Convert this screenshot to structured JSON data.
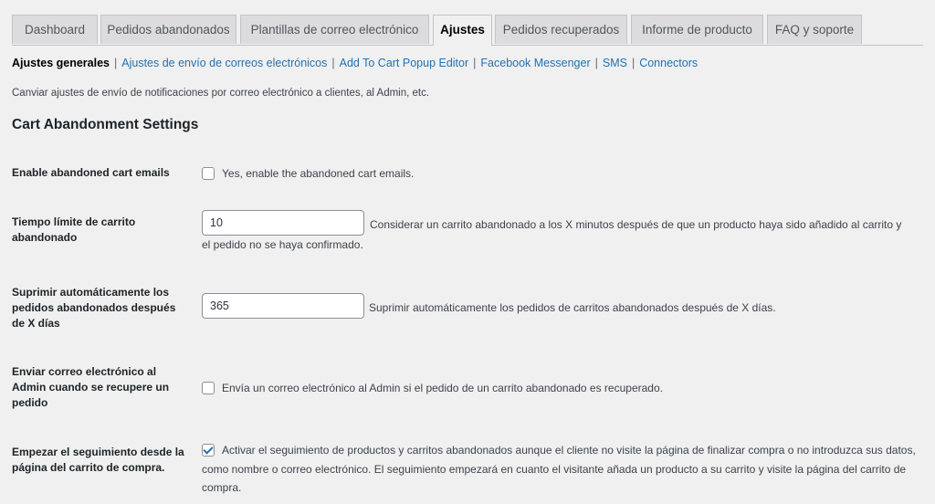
{
  "tabs": [
    {
      "label": "Dashboard",
      "active": false
    },
    {
      "label": "Pedidos abandonados",
      "active": false
    },
    {
      "label": "Plantillas de correo electrónico",
      "active": false
    },
    {
      "label": "Ajustes",
      "active": true
    },
    {
      "label": "Pedidos recuperados",
      "active": false
    },
    {
      "label": "Informe de producto",
      "active": false
    },
    {
      "label": "FAQ y soporte",
      "active": false
    }
  ],
  "subnav": {
    "current": "Ajustes generales",
    "links": [
      "Ajustes de envío de correos electrónicos",
      "Add To Cart Popup Editor",
      "Facebook Messenger",
      "SMS",
      "Connectors"
    ],
    "separator": "|"
  },
  "page_description": "Canviar ajustes de envío de notificaciones por correo electrónico a clientes, al Admin, etc.",
  "section_title": "Cart Abandonment Settings",
  "settings": {
    "enable_emails": {
      "label": "Enable abandoned cart emails",
      "checkbox_label": "Yes, enable the abandoned cart emails.",
      "checked": false
    },
    "cutoff_time": {
      "label": "Tiempo límite de carrito abandonado",
      "value": "10",
      "description": "Considerar un carrito abandonado a los X minutos después de que un producto haya sido añadido al carrito y el pedido no se haya confirmado."
    },
    "auto_delete": {
      "label": "Suprimir automáticamente los pedidos abandonados después de X días",
      "value": "365",
      "description": "Suprimir automáticamente los pedidos de carritos abandonados después de X días."
    },
    "admin_recovery_email": {
      "label": "Enviar correo electrónico al Admin cuando se recupere un pedido",
      "checkbox_label": "Envía un correo electrónico al Admin si el pedido de un carrito abandonado es recuperado.",
      "checked": false
    },
    "cart_page_tracking": {
      "label": "Empezar el seguimiento desde la página del carrito de compra.",
      "checkbox_label": "Activar el seguimiento de productos y carritos abandonados aunque el cliente no visite la página de finalizar compra o no introduzca sus datos, como nombre o correo electrónico. El seguimiento empezará en cuanto el visitante añada un producto a su carrito y visite la página del carrito de compra.",
      "checked": true
    }
  },
  "colors": {
    "link": "#2271b1",
    "background": "#f0f0f1",
    "tab_inactive": "#dcdcde"
  }
}
